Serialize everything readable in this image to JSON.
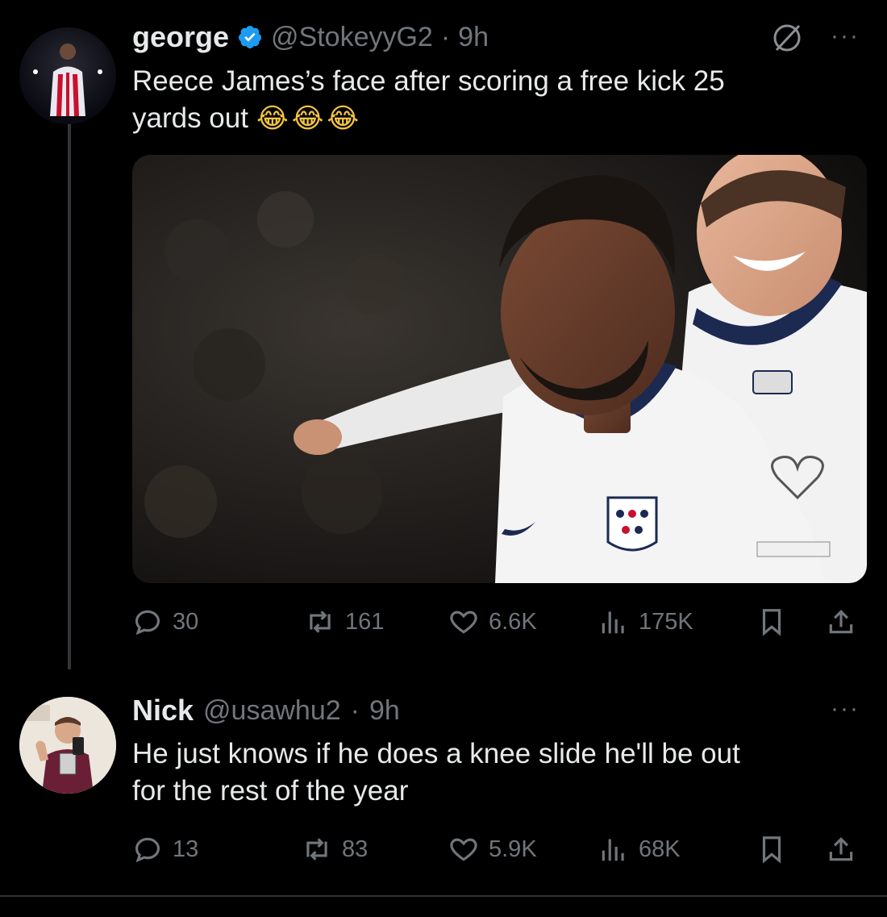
{
  "tweet1": {
    "name": "george",
    "handle": "@StokeyyG2",
    "dot": "·",
    "time": "9h",
    "text_line1": "Reece James’s face after scoring a free kick 25",
    "text_line2": "yards out",
    "emojis": "😂😂😂",
    "media_caption": "",
    "metrics": {
      "replies": "30",
      "retweets": "161",
      "likes": "6.6K",
      "views": "175K"
    }
  },
  "tweet2": {
    "name": "Nick",
    "handle": "@usawhu2",
    "dot": "·",
    "time": "9h",
    "text_line1": "He just knows if he does a knee slide he'll be out",
    "text_line2": "for the rest of the year",
    "metrics": {
      "replies": "13",
      "retweets": "83",
      "likes": "5.9K",
      "views": "68K"
    }
  },
  "more_label": "···",
  "colors": {
    "background": "#000000",
    "text": "#e7e9ea",
    "muted": "#71767b",
    "verified": "#1d9bf0"
  }
}
